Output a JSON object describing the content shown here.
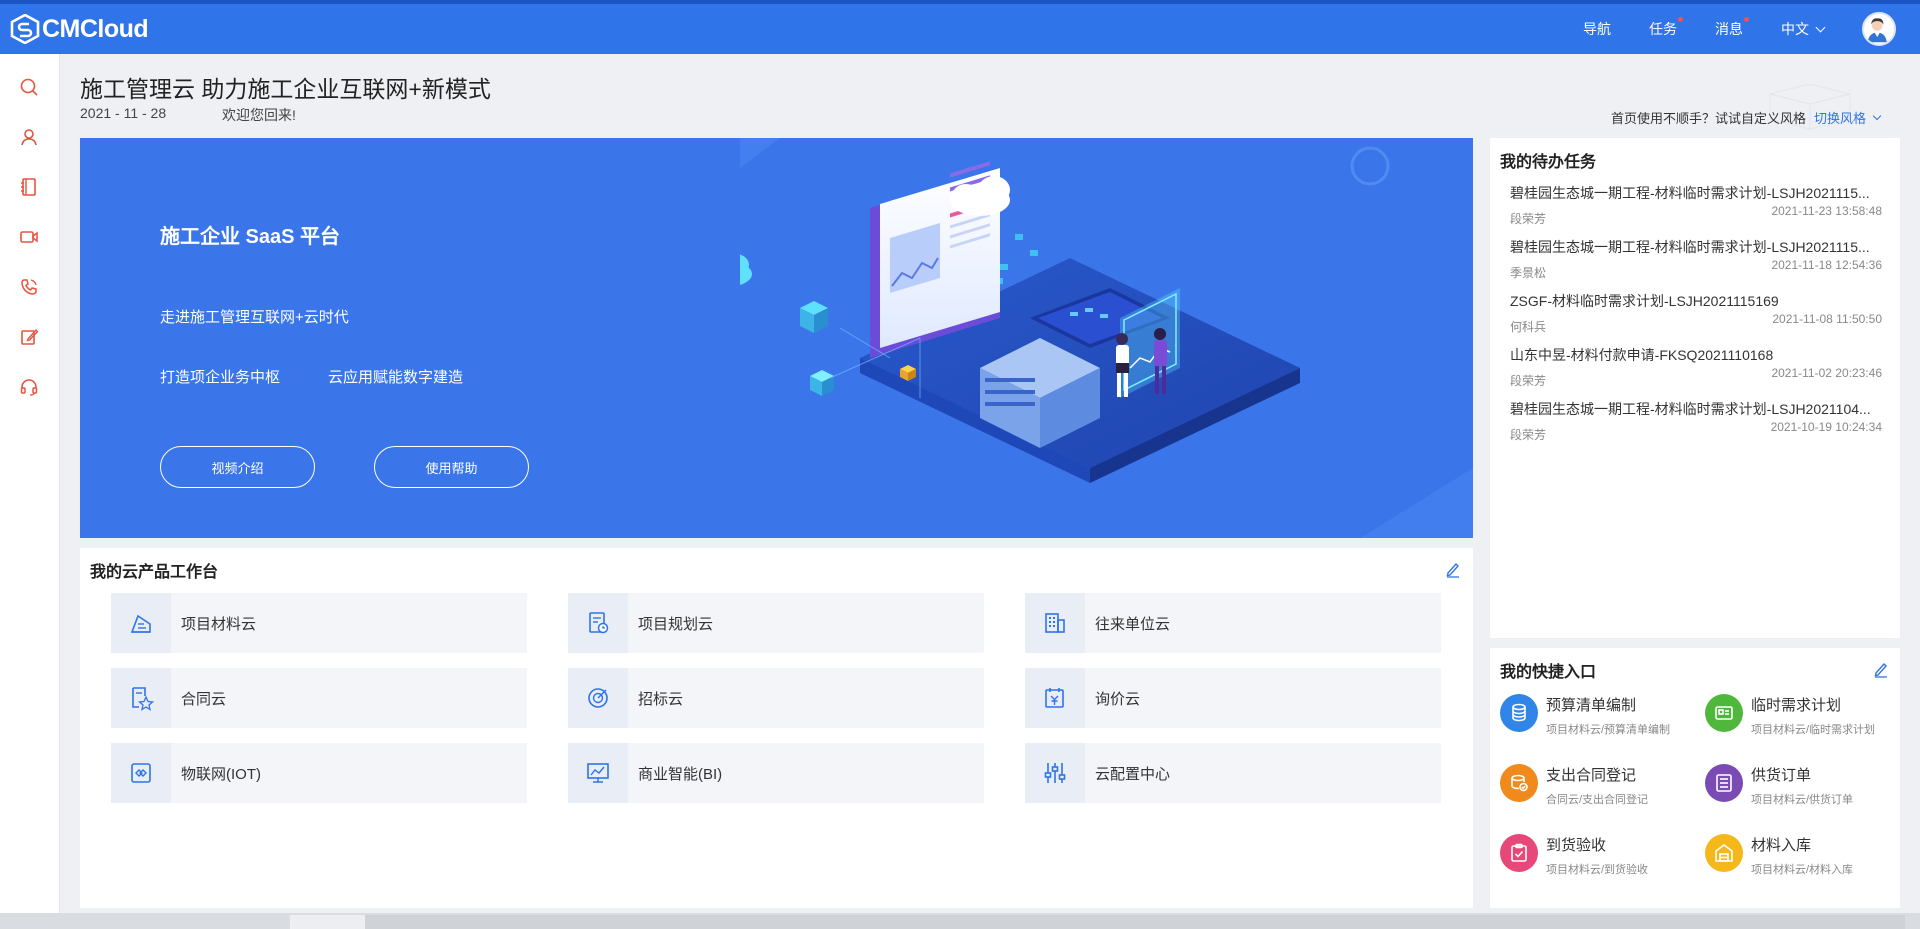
{
  "app": {
    "name": "CMCloud"
  },
  "topnav": {
    "items": [
      {
        "label": "导航",
        "dot": false
      },
      {
        "label": "任务",
        "dot": true
      },
      {
        "label": "消息",
        "dot": true
      }
    ],
    "language": "中文"
  },
  "header": {
    "title": "施工管理云 助力施工企业互联网+新模式",
    "date": "2021 - 11 - 28",
    "welcome": "欢迎您回来!",
    "customize_prompt": "首页使用不顺手？试试自定义风格",
    "customize_link": "切换风格"
  },
  "banner": {
    "title": "施工企业 SaaS 平台",
    "subtitle": "走进施工管理互联网+云时代",
    "tag1": "打造项企业务中枢",
    "tag2": "云应用赋能数字建造",
    "btn_video": "视频介绍",
    "btn_help": "使用帮助"
  },
  "todo": {
    "title": "我的待办任务",
    "items": [
      {
        "title": "碧桂园生态城一期工程-材料临时需求计划-LSJH2021115...",
        "person": "段荣芳",
        "date": "2021-11-23 13:58:48"
      },
      {
        "title": "碧桂园生态城一期工程-材料临时需求计划-LSJH2021115...",
        "person": "季景松",
        "date": "2021-11-18 12:54:36"
      },
      {
        "title": "ZSGF-材料临时需求计划-LSJH2021115169",
        "person": "何科兵",
        "date": "2021-11-08 11:50:50"
      },
      {
        "title": "山东中昱-材料付款申请-FKSQ2021110168",
        "person": "段荣芳",
        "date": "2021-11-02 20:23:46"
      },
      {
        "title": "碧桂园生态城一期工程-材料临时需求计划-LSJH2021104...",
        "person": "段荣芳",
        "date": "2021-10-19 10:24:34"
      }
    ]
  },
  "workspace": {
    "title": "我的云产品工作台",
    "cards": [
      {
        "label": "项目材料云",
        "icon": "material-cloud-icon"
      },
      {
        "label": "项目规划云",
        "icon": "planning-cloud-icon"
      },
      {
        "label": "往来单位云",
        "icon": "building-icon"
      },
      {
        "label": "合同云",
        "icon": "contract-icon"
      },
      {
        "label": "招标云",
        "icon": "target-icon"
      },
      {
        "label": "询价云",
        "icon": "inquiry-icon"
      },
      {
        "label": "物联网(IOT)",
        "icon": "iot-icon"
      },
      {
        "label": "商业智能(BI)",
        "icon": "bi-chart-icon"
      },
      {
        "label": "云配置中心",
        "icon": "sliders-icon"
      }
    ]
  },
  "quick": {
    "title": "我的快捷入口",
    "items": [
      {
        "title": "预算清单编制",
        "sub": "项目材料云/预算清单编制",
        "color": "#2f86e8",
        "icon": "database-icon"
      },
      {
        "title": "临时需求计划",
        "sub": "项目材料云/临时需求计划",
        "color": "#4fb83c",
        "icon": "card-icon"
      },
      {
        "title": "支出合同登记",
        "sub": "合同云/支出合同登记",
        "color": "#f08a1c",
        "icon": "stack-check-icon"
      },
      {
        "title": "供货订单",
        "sub": "项目材料云/供货订单",
        "color": "#7b4bb5",
        "icon": "list-icon"
      },
      {
        "title": "到货验收",
        "sub": "项目材料云/到货验收",
        "color": "#e8477a",
        "icon": "clipboard-check-icon"
      },
      {
        "title": "材料入库",
        "sub": "项目材料云/材料入库",
        "color": "#f5b81b",
        "icon": "warehouse-icon"
      }
    ]
  }
}
